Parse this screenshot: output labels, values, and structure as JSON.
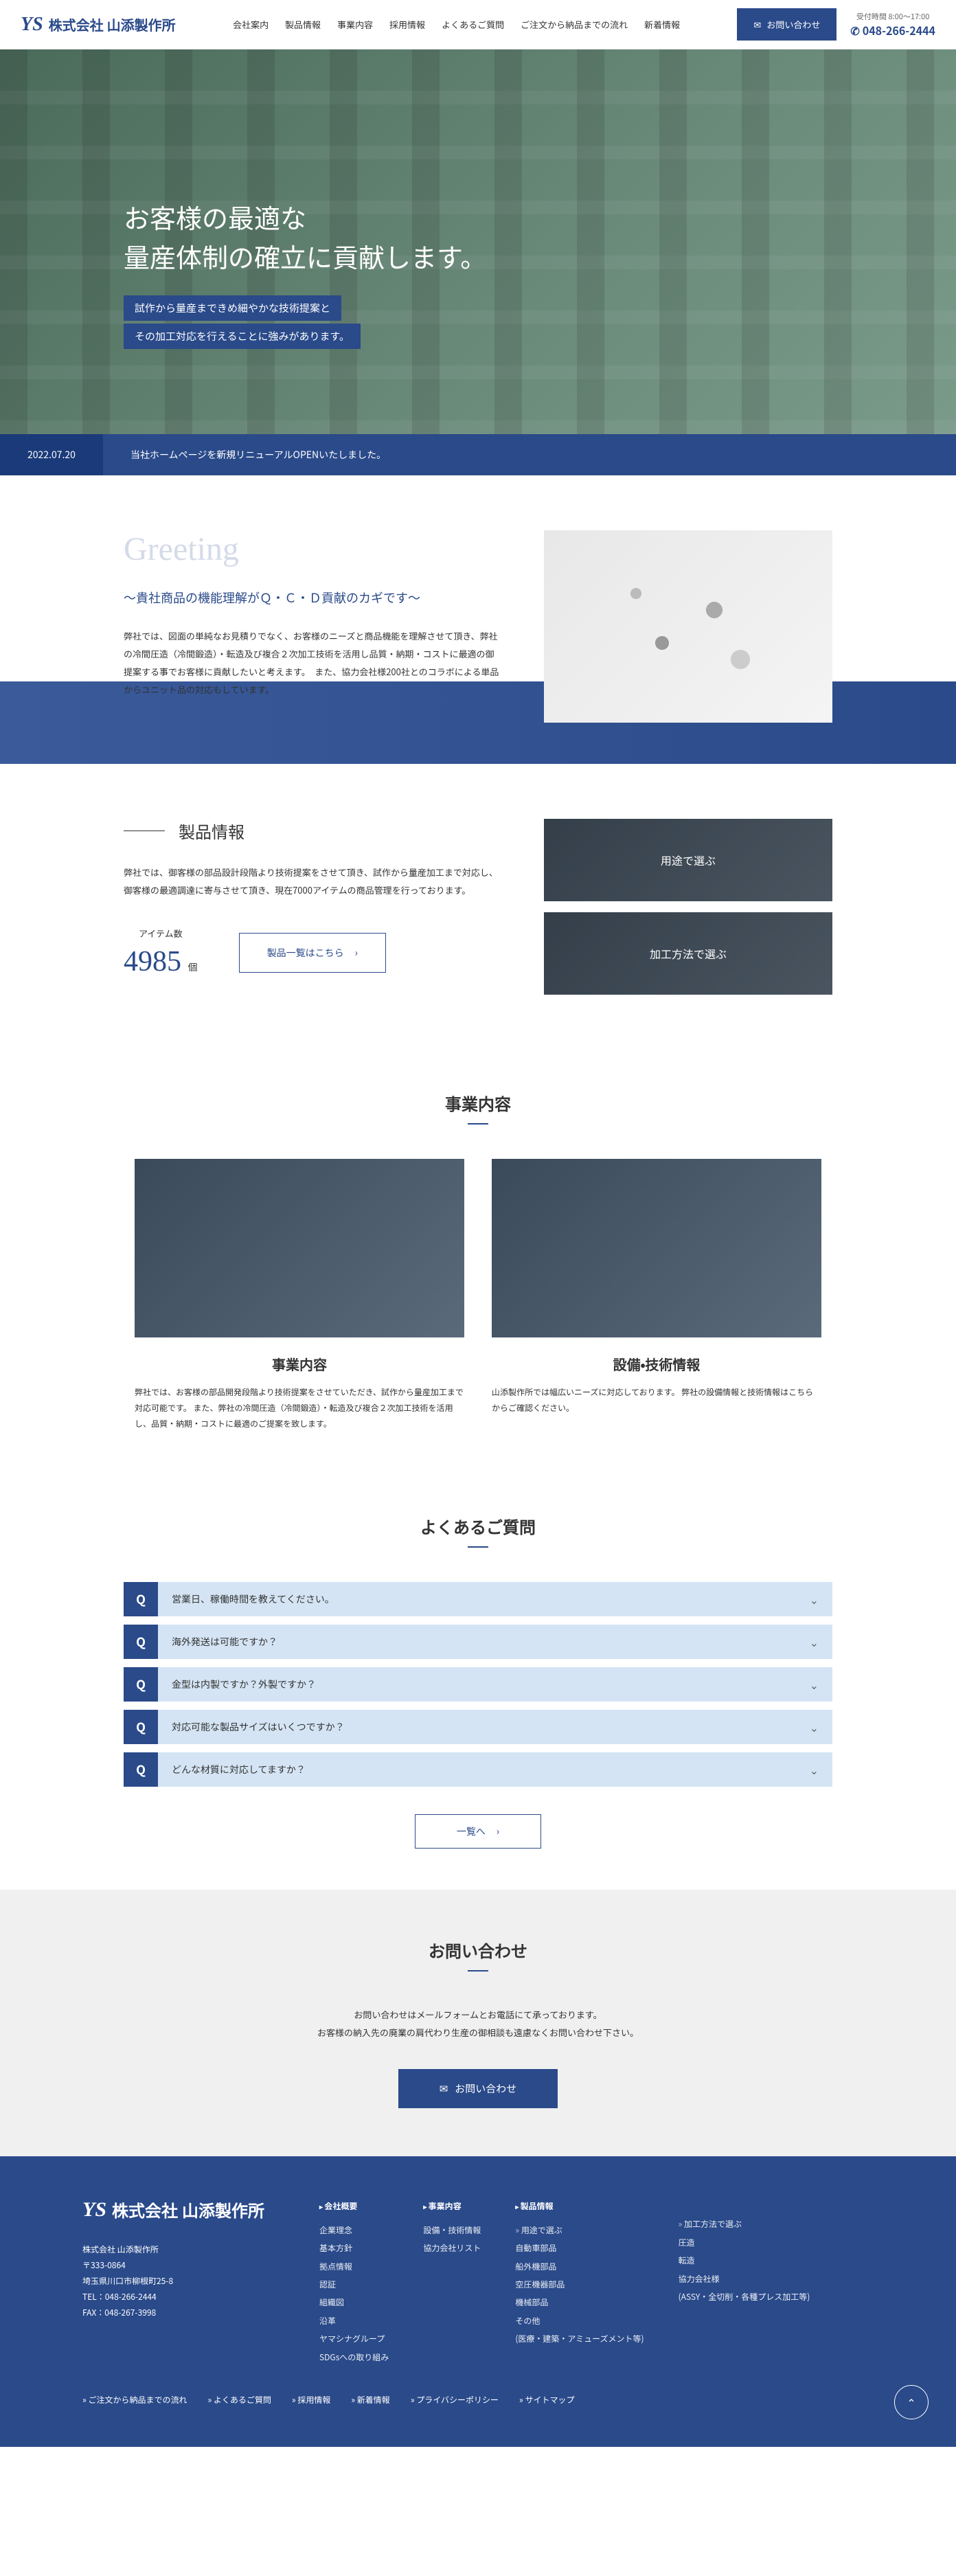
{
  "header": {
    "logo_prefix": "YS",
    "logo_text": "株式会社 山添製作所",
    "nav": [
      "会社案内",
      "製品情報",
      "事業内容",
      "採用情報",
      "よくあるご質問",
      "ご注文から納品までの流れ",
      "新着情報"
    ],
    "contact_label": "お問い合わせ",
    "hours": "受付時間 8:00～17:00",
    "phone": "048-266-2444"
  },
  "hero": {
    "title_line1": "お客様の最適な",
    "title_line2": "量産体制の確立に貢献します。",
    "sub_line1": "試作から量産まできめ細やかな技術提案と",
    "sub_line2": "その加工対応を行えることに強みがあります。"
  },
  "news": {
    "date": "2022.07.20",
    "text": "当社ホームページを新規リニューアルOPENいたしました。"
  },
  "greeting": {
    "heading": "Greeting",
    "sub": "～貴社商品の機能理解がＱ・Ｃ・Ｄ貢献のカギです～",
    "body": "弊社では、図面の単純なお見積りでなく、お客様のニーズと商品機能を理解させて頂き、弊社の冷間圧造（冷間鍛造）・転造及び複合２次加工技術を活用し品質・納期・コストに最適の御提案する事でお客様に貢献したいと考えます。　また、協力会社様200社とのコラボによる単品からユニット品の対応もしています。"
  },
  "products": {
    "title": "製品情報",
    "body": "弊社では、御客様の部品設計段階より技術提案をさせて頂き、試作から量産加工まで対応し、御客様の最適調達に寄与させて頂き、現在7000アイテムの商品管理を行っております。",
    "item_label": "アイテム数",
    "item_count": "4985",
    "item_unit": "個",
    "list_btn": "製品一覧はこちら",
    "card1": "用途で選ぶ",
    "card2": "加工方法で選ぶ"
  },
  "business": {
    "title": "事業内容",
    "card1_title": "事業内容",
    "card1_body": "弊社では、お客様の部品開発段階より技術提案をさせていただき、試作から量産加工まで対応可能です。\nまた、弊社の冷間圧造（冷間鍛造）・転造及び複合２次加工技術を活用し、品質・納期・コストに最適のご提案を致します。",
    "card2_title": "設備・技術情報",
    "card2_body": "山添製作所では幅広いニーズに対応しております。\n弊社の設備情報と技術情報はこちらからご確認ください。"
  },
  "faq": {
    "title": "よくあるご質問",
    "items": [
      "営業日、稼働時間を教えてください。",
      "海外発送は可能ですか？",
      "金型は内製ですか？外製ですか？",
      "対応可能な製品サイズはいくつですか？",
      "どんな材質に対応してますか？"
    ],
    "more": "一覧へ"
  },
  "contact": {
    "title": "お問い合わせ",
    "body_line1": "お問い合わせはメールフォームとお電話にて承っております。",
    "body_line2": "お客様の納入先の廃業の肩代わり生産の御相談も遠慮なくお問い合わせ下さい。",
    "btn": "お問い合わせ"
  },
  "footer": {
    "logo_prefix": "YS",
    "logo_text": "株式会社 山添製作所",
    "company_name": "株式会社 山添製作所",
    "postal": "〒333-0864",
    "address": "埼玉県川口市柳根町25-8",
    "tel": "TEL：048-266-2444",
    "fax": "FAX：048-267-3998",
    "cols": [
      {
        "title": "会社概要",
        "links": [
          "企業理念",
          "基本方針",
          "拠点情報",
          "認証",
          "組織図",
          "沿革",
          "ヤマシナグループ",
          "SDGsへの取り組み"
        ]
      },
      {
        "title": "事業内容",
        "links": [
          "設備・技術情報",
          "協力会社リスト"
        ]
      },
      {
        "title": "製品情報",
        "sub": "用途で選ぶ",
        "links": [
          "自動車部品",
          "船外機部品",
          "空圧機器部品",
          "機械部品",
          "その他",
          "(医療・建築・アミューズメント等)"
        ]
      },
      {
        "title": "",
        "sub": "加工方法で選ぶ",
        "links": [
          "圧造",
          "転造",
          "協力会社様",
          "(ASSY・全切削・各種プレス加工等)"
        ]
      }
    ],
    "bottom_links": [
      "ご注文から納品までの流れ",
      "よくあるご質問",
      "採用情報",
      "新着情報",
      "プライバシーポリシー",
      "サイトマップ"
    ]
  }
}
